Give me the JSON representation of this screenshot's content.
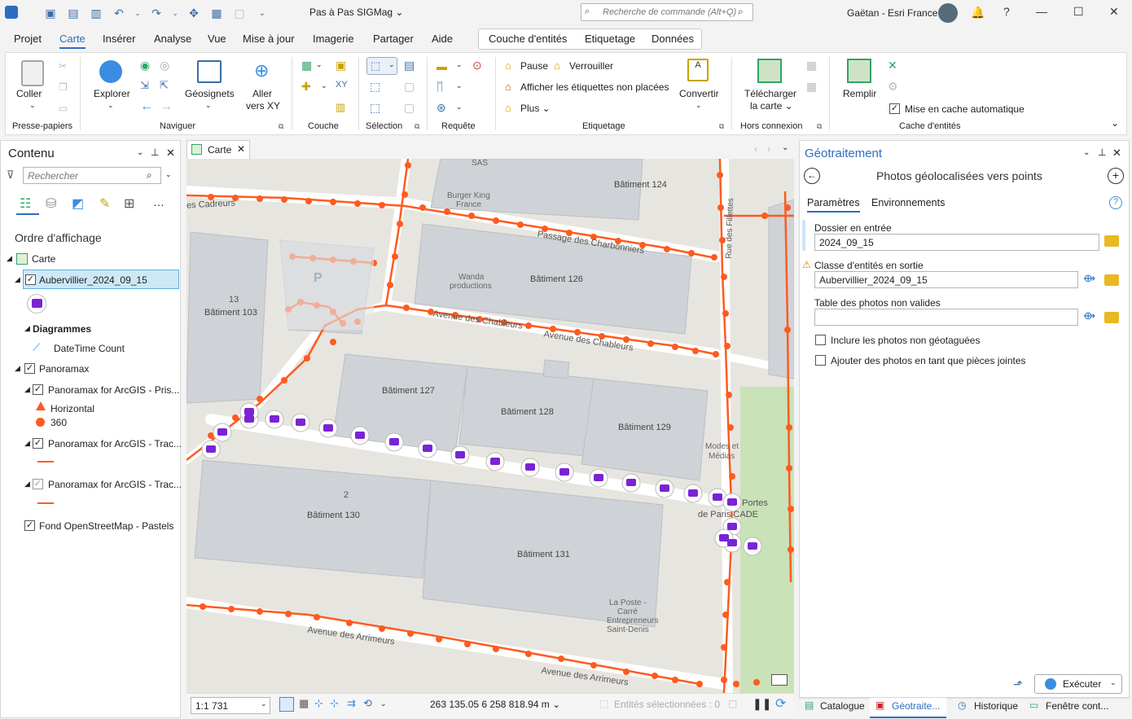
{
  "titlebar": {
    "project_title": "Pas à Pas SIGMag ⌄",
    "command_search_placeholder": "Recherche de commande (Alt+Q)",
    "user": "Gaëtan - Esri France"
  },
  "tabs": [
    "Projet",
    "Carte",
    "Insérer",
    "Analyse",
    "Vue",
    "Mise à jour",
    "Imagerie",
    "Partager",
    "Aide"
  ],
  "context_tabs": [
    "Couche d'entités",
    "Etiquetage",
    "Données"
  ],
  "ribbon": {
    "clipboard": {
      "paste": "Coller",
      "group": "Presse-papiers"
    },
    "navigate": {
      "explore": "Explorer",
      "bookmarks": "Géosignets",
      "goto_xy_1": "Aller",
      "goto_xy_2": "vers XY",
      "group": "Naviguer"
    },
    "layer": {
      "group": "Couche"
    },
    "selection": {
      "group": "Sélection"
    },
    "query": {
      "group": "Requête"
    },
    "labeling": {
      "pause": "Pause",
      "lock": "Verrouiller",
      "unplaced": "Afficher les étiquettes non placées",
      "more": "Plus ⌄",
      "convert": "Convertir",
      "group": "Etiquetage"
    },
    "offline": {
      "download_1": "Télécharger",
      "download_2": "la carte ⌄",
      "group": "Hors connexion"
    },
    "cache": {
      "fill": "Remplir",
      "auto_cache": "Mise en cache automatique",
      "group": "Cache d'entités"
    }
  },
  "contents": {
    "title": "Contenu",
    "search_placeholder": "Rechercher",
    "drawing_order": "Ordre d'affichage",
    "items": {
      "map": "Carte",
      "layer_aub": "Aubervillier_2024_09_15",
      "charts": "Diagrammes",
      "chart_item": "DateTime Count",
      "panoramax": "Panoramax",
      "pano_1": "Panoramax for ArcGIS - Pris...",
      "legend_horizontal": "Horizontal",
      "legend_360": "360",
      "pano_2": "Panoramax for ArcGIS - Trac...",
      "pano_3": "Panoramax for ArcGIS - Trac...",
      "basemap": "Fond OpenStreetMap - Pastels"
    }
  },
  "map_view": {
    "tab_label": "Carte",
    "labels": {
      "b124": "Bâtiment 124",
      "b126": "Bâtiment 126",
      "b103": "Bâtiment 103",
      "n13": "13",
      "b127": "Bâtiment 127",
      "b128": "Bâtiment 128",
      "b129": "Bâtiment 129",
      "b130": "Bâtiment 130",
      "n2": "2",
      "b131": "Bâtiment 131",
      "sas": "SAS",
      "burger": "Burger King",
      "france": "France",
      "wanda1": "Wanda",
      "wanda2": "productions",
      "passage": "Passage des Charbonniers",
      "chableurs1": "Avenue des Chableurs",
      "chableurs2": "Avenue des Chableurs",
      "arrimeurs1": "Avenue des Arrimeurs",
      "arrimeurs2": "Avenue des Arrimeurs",
      "cadreurs": "es Cadreurs",
      "filletes": "Rue des Fillettes",
      "modes1": "Modes et",
      "modes2": "Médias",
      "portes1": "Portes",
      "portes2": "de Paris CADE",
      "poste1": "La Poste -",
      "poste2": "Carré",
      "poste3": "Entrepreneurs",
      "poste4": "Saint-Denis",
      "parking": "P"
    },
    "scale": "1:1 731",
    "coords": "263 135.05 6 258 818.94 m ⌄",
    "selected": "Entités sélectionnées : 0"
  },
  "geoprocessing": {
    "title": "Géotraitement",
    "tool_name": "Photos géolocalisées vers points",
    "tab_params": "Paramètres",
    "tab_env": "Environnements",
    "input_folder_label": "Dossier en entrée",
    "input_folder_value": "2024_09_15",
    "output_fc_label": "Classe d'entités en sortie",
    "output_fc_value": "Aubervillier_2024_09_15",
    "invalid_table_label": "Table des photos non valides",
    "invalid_table_value": "",
    "include_nongeo": "Inclure les photos non géotaguées",
    "add_attachments": "Ajouter des photos en tant que pièces jointes",
    "run": "Exécuter"
  },
  "bottom_tabs": [
    "Catalogue",
    "Géotraite...",
    "Historique",
    "Fenêtre cont..."
  ],
  "colors": {
    "accent": "#2c6dc1",
    "track": "#ff5a1f",
    "photo": "#7a23d6",
    "building": "#cfd3d7"
  }
}
